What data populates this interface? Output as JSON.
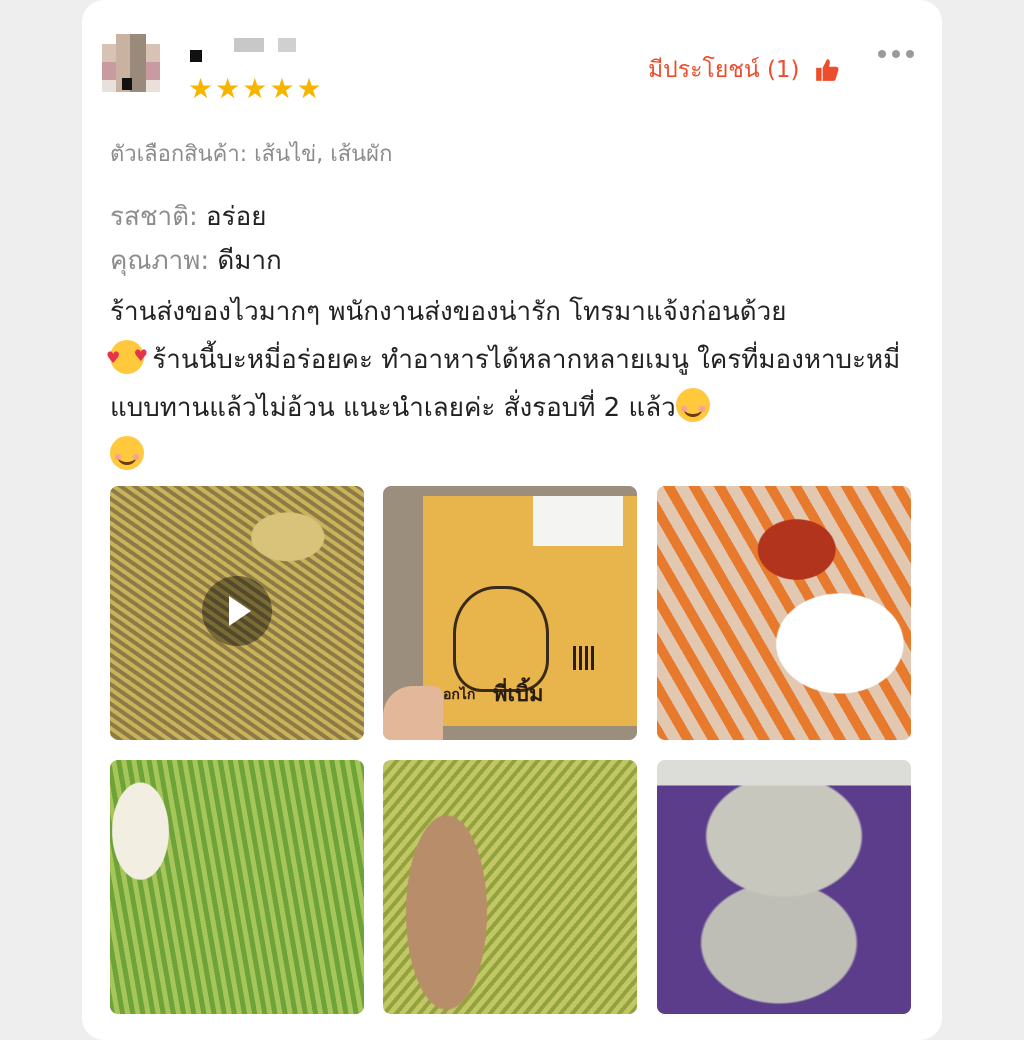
{
  "review": {
    "helpful_label": "มีประโยชน์ (1)",
    "rating": 5,
    "variation": "ตัวเลือกสินค้า: เส้นไข่, เส้นผัก",
    "attributes": [
      {
        "label": "รสชาติ:",
        "value": "อร่อย"
      },
      {
        "label": "คุณภาพ:",
        "value": "ดีมาก"
      }
    ],
    "text_1": "ร้านส่งของไวมากๆ พนักงานส่งของน่ารัก โทรมาแจ้งก่อนด้วย",
    "text_2": " ร้านนี้บะหมี่อร่อยคะ ทำอาหารได้หลากหลายเมนู ใครที่มองหาบะหมี่แบบทานแล้วไม่อ้วน แนะนำเลยค่ะ สั่งรอบที่ 2 แล้ว",
    "box_brand_small": "อกไก่",
    "box_brand_large": "พี่เบิ้ม",
    "icons": {
      "thumb": "thumbs-up-icon",
      "more": "more-horizontal-icon",
      "play": "play-icon",
      "emoji_1": "smiling-face-with-hearts-emoji",
      "emoji_2": "smiling-face-emoji"
    },
    "colors": {
      "accent": "#ee4d2d",
      "star": "#f7b500"
    }
  }
}
